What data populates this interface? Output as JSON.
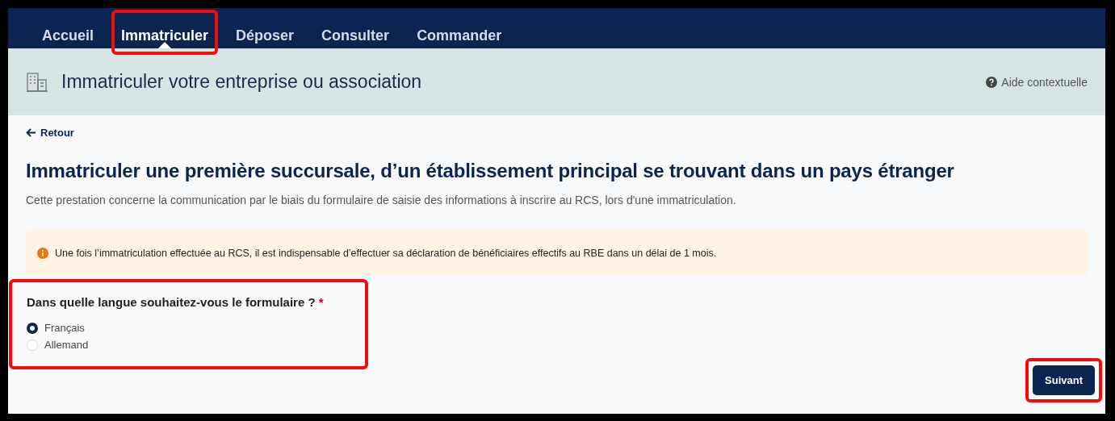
{
  "nav": {
    "tabs": [
      {
        "label": "Accueil",
        "selected": false,
        "highlighted": false
      },
      {
        "label": "Immatriculer",
        "selected": true,
        "highlighted": true
      },
      {
        "label": "Déposer",
        "selected": false,
        "highlighted": false
      },
      {
        "label": "Consulter",
        "selected": false,
        "highlighted": false
      },
      {
        "label": "Commander",
        "selected": false,
        "highlighted": false
      }
    ]
  },
  "header": {
    "title": "Immatriculer votre entreprise ou association",
    "help": "Aide contextuelle"
  },
  "back_link": "Retour",
  "title": "Immatriculer une première succursale, d’un établissement principal se trouvant dans un pays étranger",
  "description": "Cette prestation concerne la communication par le biais du formulaire de saisie des informations à inscrire au RCS, lors d'une immatriculation.",
  "alert": {
    "text": "Une fois l’immatriculation effectuée au RCS, il est indispensable d’effectuer sa déclaration de bénéficiaires effectifs au RBE dans un délai de 1 mois."
  },
  "question": {
    "label": "Dans quelle langue souhaitez-vous le formulaire ?",
    "required": "*",
    "highlighted": true,
    "options": [
      {
        "label": "Français",
        "selected": true
      },
      {
        "label": "Allemand",
        "selected": false
      }
    ]
  },
  "button": {
    "label": "Suivant",
    "highlighted": true
  }
}
